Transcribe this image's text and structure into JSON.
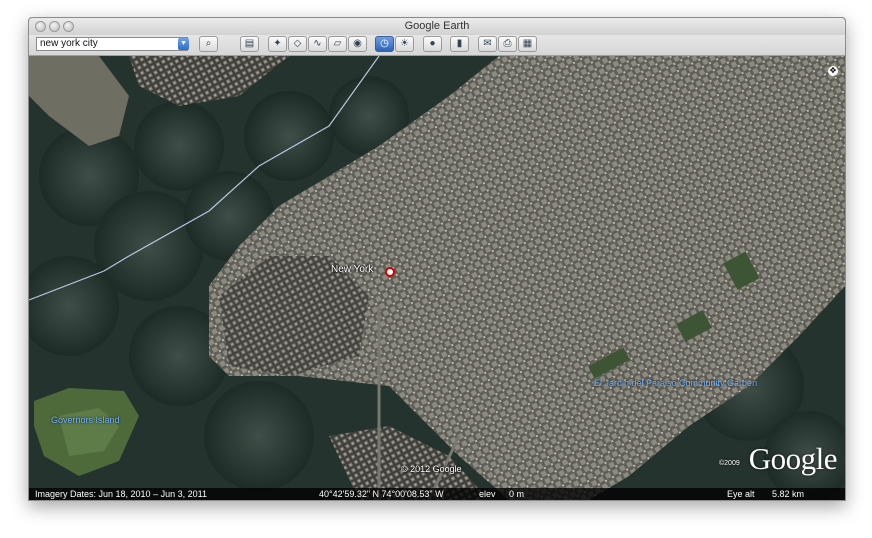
{
  "window": {
    "title": "Google Earth"
  },
  "search": {
    "value": "new york city"
  },
  "toolbar": {
    "icons": [
      "search-icon",
      "sidebar-icon",
      "placemark-icon",
      "polygon-icon",
      "path-icon",
      "overlay-icon",
      "record-tour-icon",
      "historical-imagery-icon",
      "sunlight-icon",
      "planets-icon",
      "ruler-icon",
      "email-icon",
      "print-icon",
      "maps-icon"
    ]
  },
  "map": {
    "city_label": "New York",
    "island_label": "Governors Island",
    "park_label": "El Jardin del Paraiso Community Garden",
    "copyright": "© 2012 Google",
    "logo_copyright": "©2009",
    "logo_text": "Google"
  },
  "status": {
    "imagery_dates": "Imagery Dates: Jun 18, 2010 – Jun  3, 2011",
    "coords": "40°42'59.32\" N   74°00'08.53\" W",
    "elev_label": "elev",
    "elev_value": "0 m",
    "eye_alt_label": "Eye alt",
    "eye_alt_value": "5.82 km"
  }
}
